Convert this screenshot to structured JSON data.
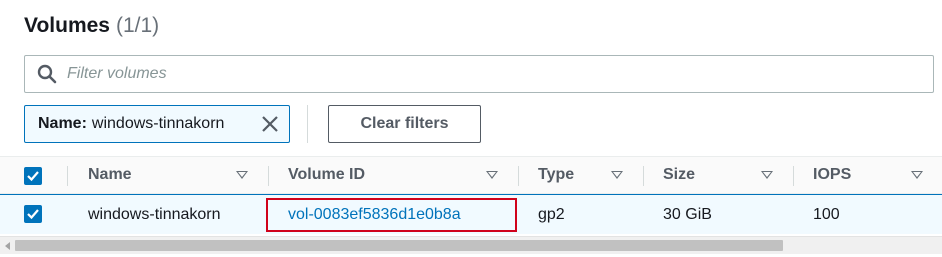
{
  "header": {
    "title": "Volumes",
    "count": "(1/1)"
  },
  "search": {
    "placeholder": "Filter volumes",
    "value": ""
  },
  "filter_token": {
    "key": "Name:",
    "value": "windows-tinnakorn"
  },
  "clear_filters_label": "Clear filters",
  "table": {
    "columns": [
      "Name",
      "Volume ID",
      "Type",
      "Size",
      "IOPS"
    ],
    "rows": [
      {
        "name": "windows-tinnakorn",
        "volume_id": "vol-0083ef5836d1e0b8a",
        "type": "gp2",
        "size": "30 GiB",
        "iops": "100",
        "selected": true
      }
    ]
  },
  "colors": {
    "accent": "#0073bb",
    "highlight_box": "#d0021b",
    "selected_row_bg": "#f1faff"
  }
}
